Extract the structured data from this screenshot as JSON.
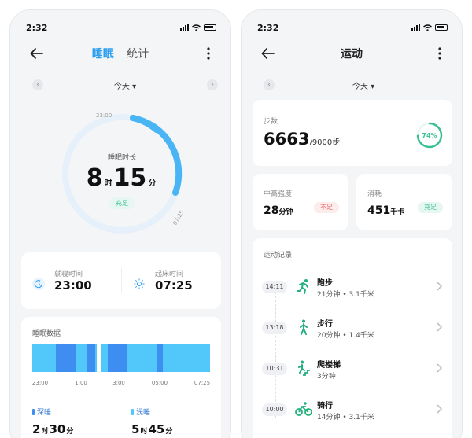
{
  "left": {
    "status": {
      "time": "2:32"
    },
    "header": {
      "tab_active": "睡眠",
      "tab_other": "统计"
    },
    "date": {
      "label": "今天"
    },
    "ring": {
      "label": "睡眠时长",
      "hours": "8",
      "hours_unit": "时",
      "minutes": "15",
      "minutes_unit": "分",
      "badge": "充足",
      "start_tick": "23:00",
      "end_tick": "07:25"
    },
    "bedtime": {
      "sleep_label": "就寝时间",
      "sleep_value": "23:00",
      "wake_label": "起床时间",
      "wake_value": "07:25"
    },
    "sleep_data": {
      "title": "睡眠数据",
      "x_labels": [
        "23:00",
        "1:00",
        "3:00",
        "05:00",
        "07:25"
      ],
      "deep": {
        "label": "深睡",
        "hours": "2",
        "hours_unit": "时",
        "minutes": "30",
        "minutes_unit": "分"
      },
      "light": {
        "label": "浅睡",
        "hours": "5",
        "hours_unit": "时",
        "minutes": "45",
        "minutes_unit": "分"
      },
      "colors": {
        "light": "#52c8fa",
        "deep": "#3d8ef0"
      }
    }
  },
  "right": {
    "status": {
      "time": "2:32"
    },
    "header": {
      "title": "运动"
    },
    "date": {
      "label": "今天"
    },
    "steps": {
      "label": "步数",
      "value": "6663",
      "goal": "/9000步",
      "percent": "74%",
      "progress": 0.74
    },
    "intensity": {
      "label": "中高强度",
      "value": "28",
      "unit": "分钟",
      "badge": "不足"
    },
    "calories": {
      "label": "消耗",
      "value": "451",
      "unit": "千卡",
      "badge": "充足"
    },
    "records": {
      "title": "运动记录",
      "items": [
        {
          "time": "14:11",
          "name": "跑步",
          "detail": "21分钟 • 3.1千米",
          "icon": "running-icon"
        },
        {
          "time": "13:18",
          "name": "步行",
          "detail": "20分钟 • 1.4千米",
          "icon": "walking-icon"
        },
        {
          "time": "10:31",
          "name": "爬楼梯",
          "detail": "3分钟",
          "icon": "stairs-icon"
        },
        {
          "time": "10:00",
          "name": "骑行",
          "detail": "14分钟 • 3.1千米",
          "icon": "cycling-icon"
        }
      ]
    }
  },
  "colors": {
    "accent": "#2d9ef0",
    "green": "#3bbf95",
    "red": "#e85c5c"
  }
}
